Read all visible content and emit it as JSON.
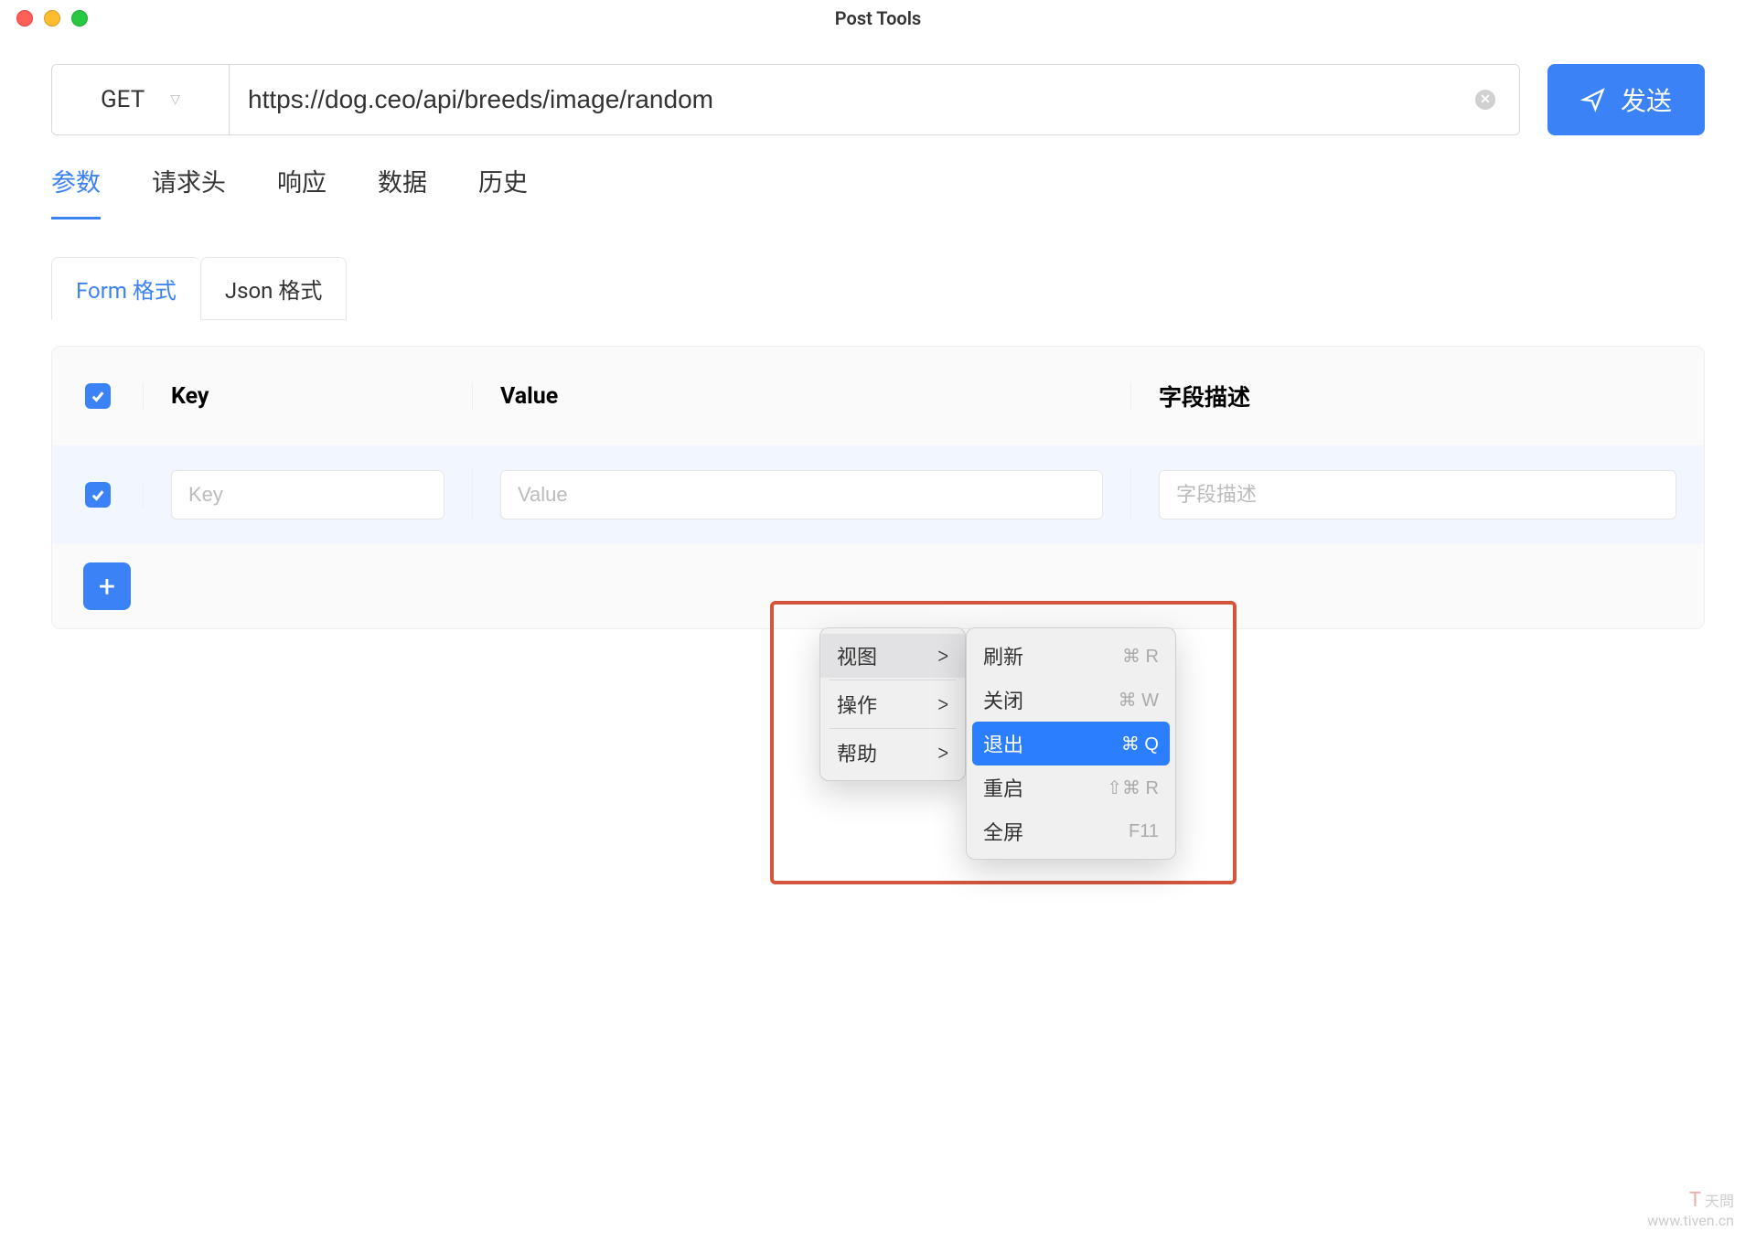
{
  "window": {
    "title": "Post Tools"
  },
  "request": {
    "method": "GET",
    "url": "https://dog.ceo/api/breeds/image/random",
    "send_label": "发送"
  },
  "main_tabs": {
    "params": "参数",
    "headers": "请求头",
    "response": "响应",
    "data": "数据",
    "history": "历史"
  },
  "sub_tabs": {
    "form": "Form 格式",
    "json": "Json 格式"
  },
  "table": {
    "header_key": "Key",
    "header_value": "Value",
    "header_desc": "字段描述",
    "placeholder_key": "Key",
    "placeholder_value": "Value",
    "placeholder_desc": "字段描述"
  },
  "context_menu": {
    "main": {
      "view": "视图",
      "action": "操作",
      "help": "帮助"
    },
    "sub": {
      "refresh": {
        "label": "刷新",
        "shortcut": "⌘ R"
      },
      "close": {
        "label": "关闭",
        "shortcut": "⌘ W"
      },
      "quit": {
        "label": "退出",
        "shortcut": "⌘ Q"
      },
      "restart": {
        "label": "重启",
        "shortcut": "⇧⌘ R"
      },
      "fullscreen": {
        "label": "全屏",
        "shortcut": "F11"
      }
    }
  },
  "watermark": {
    "logo": "T",
    "name": "天問",
    "url": "www.tiven.cn"
  }
}
